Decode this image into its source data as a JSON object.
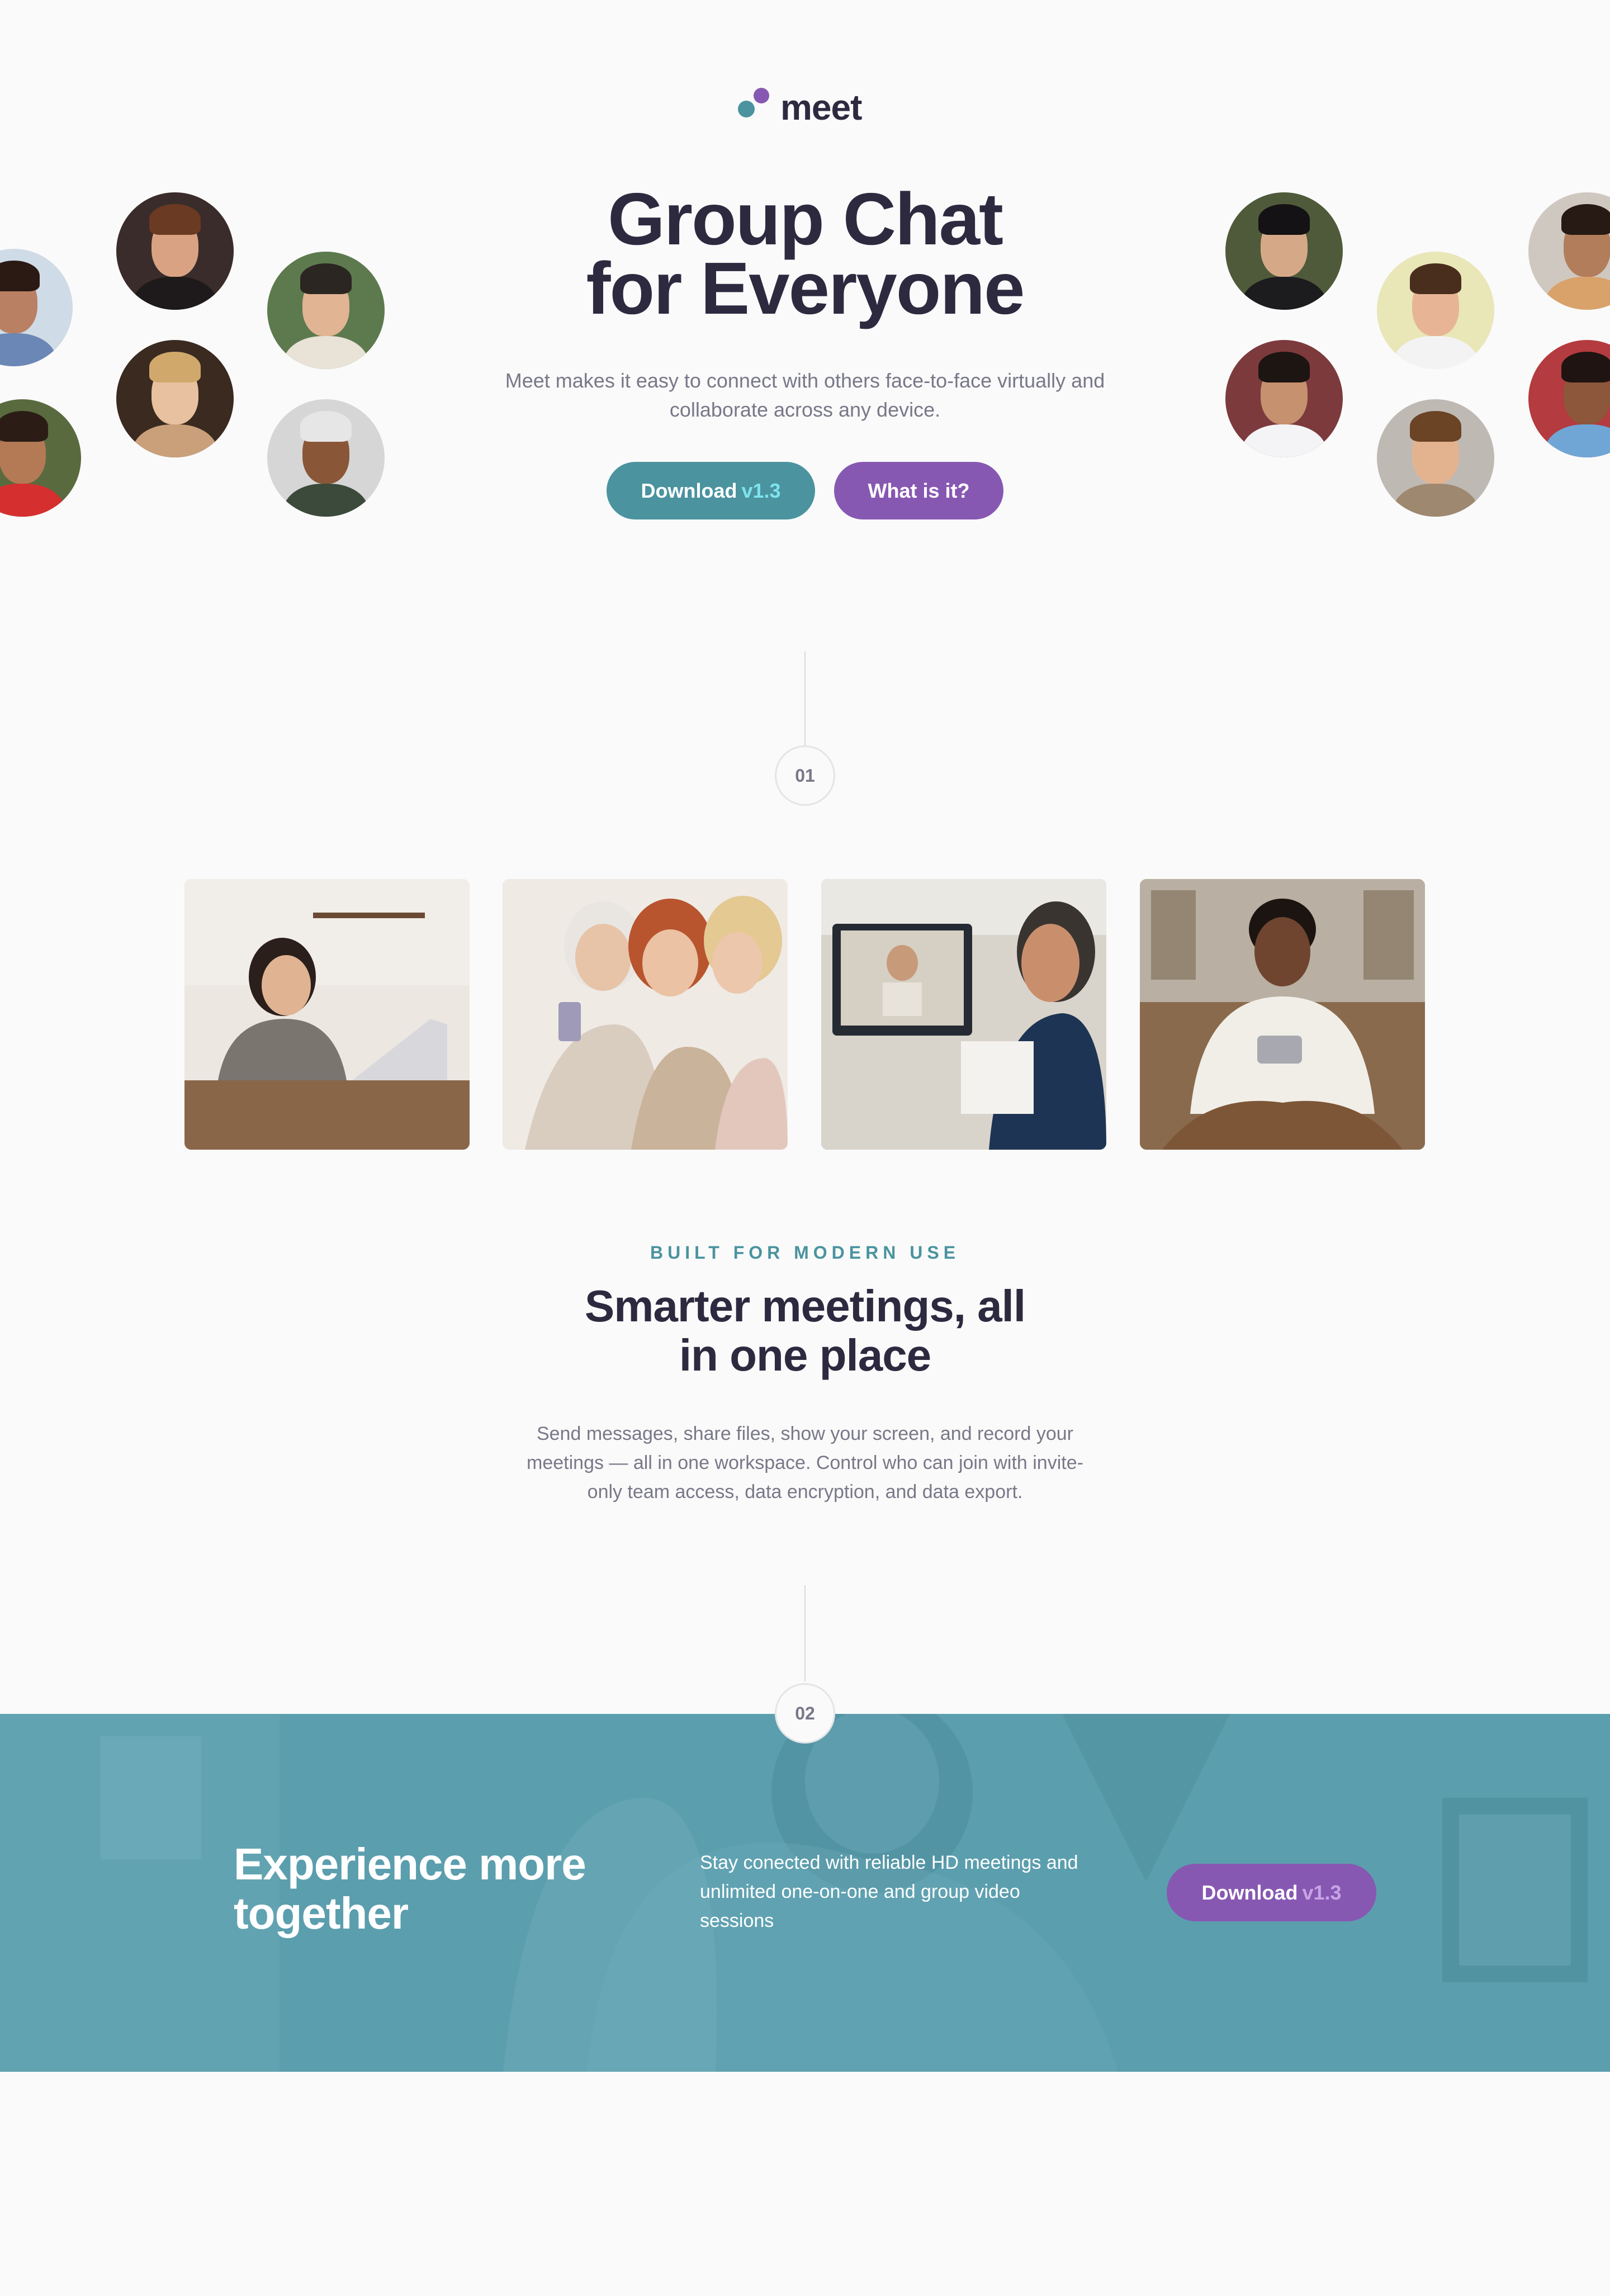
{
  "logo": {
    "text": "meet"
  },
  "hero": {
    "title_line1": "Group Chat",
    "title_line2": "for Everyone",
    "subtitle": "Meet makes it easy to connect with others face-to-face virtually and collaborate across any device.",
    "download_label": "Download",
    "download_version": "v1.3",
    "what_label": "What is it?"
  },
  "steps": {
    "one": "01",
    "two": "02"
  },
  "section": {
    "eyebrow": "BUILT FOR MODERN USE",
    "title_line1": "Smarter meetings, all",
    "title_line2": "in one place",
    "body": "Send messages, share files, show your screen, and record your meetings — all in one workspace. Control who can join with invite-only team access, data encryption, and data export."
  },
  "cta": {
    "title_line1": "Experience more",
    "title_line2": "together",
    "body": "Stay conected with reliable HD meetings and unlimited one-on-one and group video sessions",
    "download_label": "Download",
    "download_version": "v1.3"
  },
  "colors": {
    "teal": "#4a939f",
    "purple": "#8758b2",
    "dark": "#2d2a40",
    "muted": "#787889",
    "band": "#5b9eae"
  }
}
